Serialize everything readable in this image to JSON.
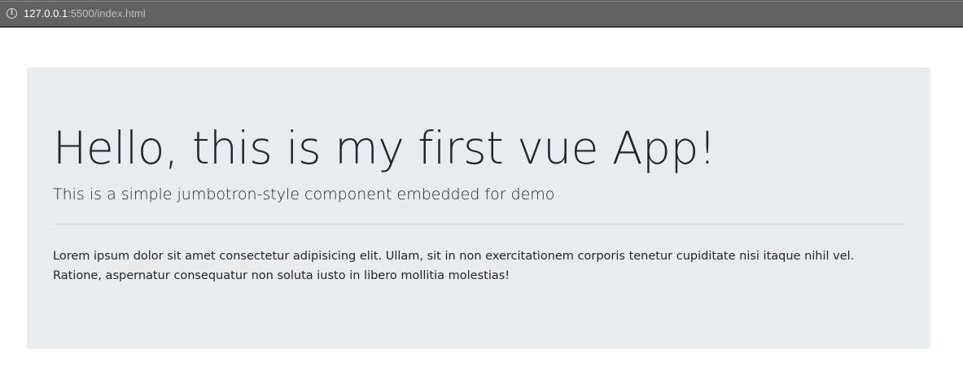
{
  "browser": {
    "url_host": "127.0.0.1",
    "url_path": ":5500/index.html",
    "info_icon_glyph": "i"
  },
  "jumbotron": {
    "title": "Hello, this is my first vue App!",
    "lead": "This is a simple jumbotron-style component embedded for demo",
    "body": "Lorem ipsum dolor sit amet consectetur adipisicing elit. Ullam, sit in non exercitationem corporis tenetur cupiditate nisi itaque nihil vel. Ratione, aspernatur consequatur non soluta iusto in libero mollitia molestias!"
  },
  "colors": {
    "address_bar": "#626262",
    "jumbotron_bg": "#e9ecef",
    "text": "#212529"
  }
}
